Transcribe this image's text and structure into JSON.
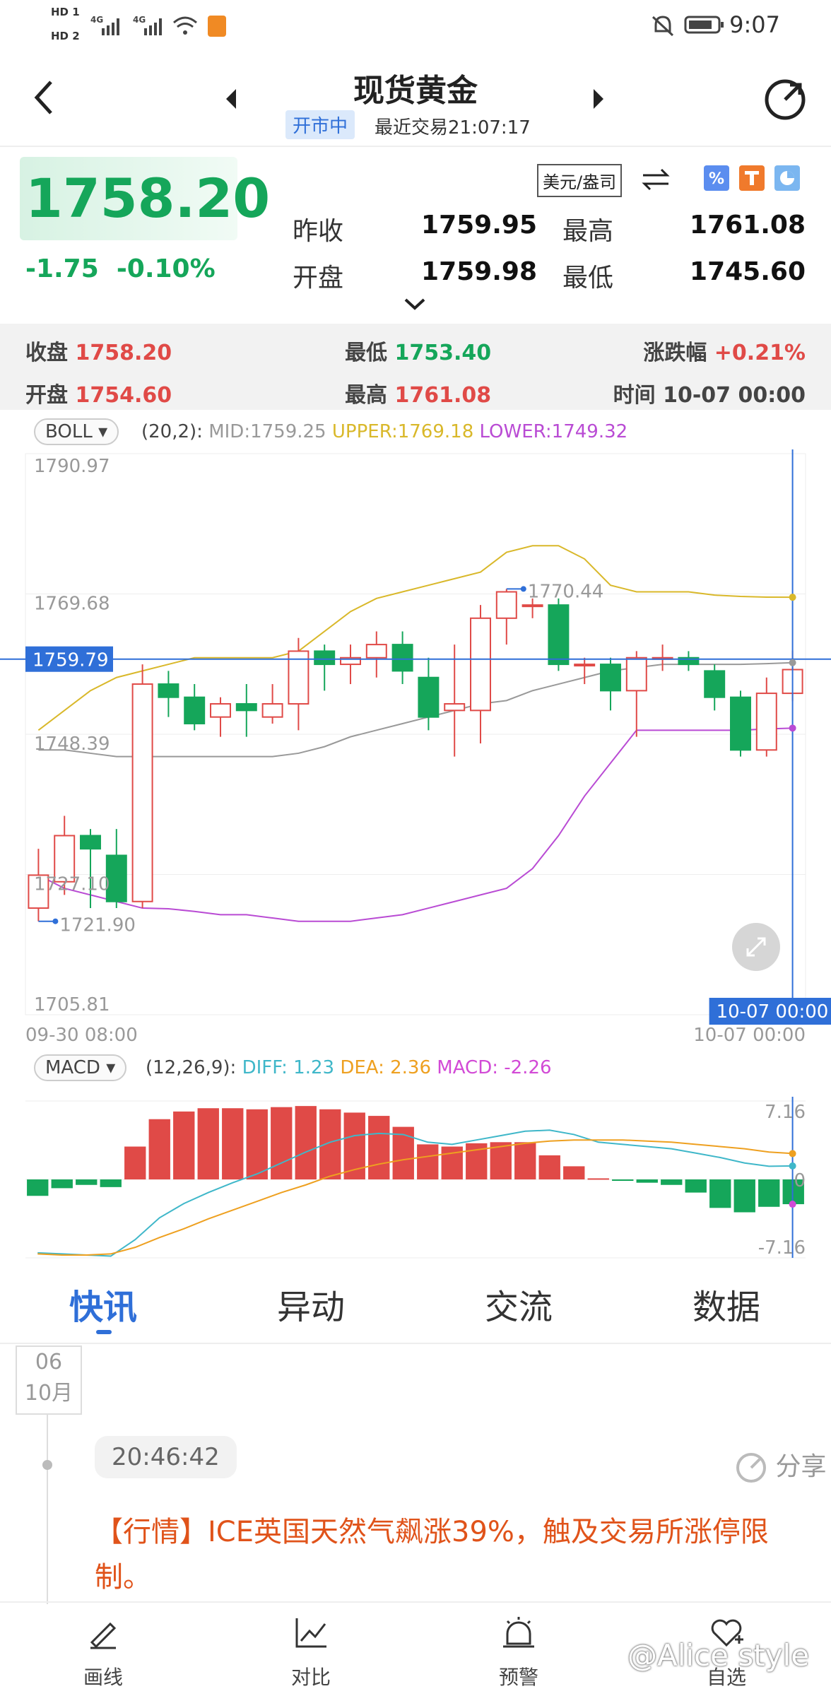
{
  "status_bar": {
    "time": "9:07",
    "hd1": "HD 1",
    "hd2": "HD 2",
    "net1": "4G",
    "net2": "4G"
  },
  "header": {
    "title": "现货黄金",
    "market_status": "开市中",
    "last_trade": "最近交易21:07:17"
  },
  "quote": {
    "price": "1758.20",
    "change": "-1.75",
    "change_pct": "-0.10%",
    "unit": "美元/盎司",
    "prev_close_label": "昨收",
    "prev_close": "1759.95",
    "open_label": "开盘",
    "open": "1759.98",
    "high_label": "最高",
    "high": "1761.08",
    "low_label": "最低",
    "low": "1745.60"
  },
  "candle_info": {
    "close_label": "收盘",
    "close": "1758.20",
    "low_label": "最低",
    "low": "1753.40",
    "chg_label": "涨跌幅",
    "chg": "+0.21%",
    "open_label": "开盘",
    "open": "1754.60",
    "high_label": "最高",
    "high": "1761.08",
    "time_label": "时间",
    "time": "10-07 00:00"
  },
  "boll": {
    "selector": "BOLL",
    "params": "(20,2):",
    "mid": "MID:1759.25",
    "upper": "UPPER:1769.18",
    "lower": "LOWER:1749.32",
    "y_ticks": [
      "1790.97",
      "1769.68",
      "1748.39",
      "1727.10",
      "1705.81"
    ],
    "cursor_price": "1759.79",
    "cursor_time": "10-07 00:00",
    "max_label": "1770.44",
    "min_label": "1721.90",
    "x_start": "09-30 08:00",
    "x_end": "10-07 00:00"
  },
  "macd": {
    "selector": "MACD",
    "params": "(12,26,9):",
    "diff": "DIFF: 1.23",
    "dea": "DEA: 2.36",
    "macd": "MACD: -2.26",
    "y_ticks": [
      "7.16",
      "0",
      "-7.16"
    ]
  },
  "colors": {
    "up": "#e04a47",
    "down": "#15a65a",
    "upper": "#d9b82a",
    "mid": "#999999",
    "lower": "#b94bd4",
    "diff": "#3fb7c9",
    "dea": "#eea020",
    "cursor": "#2f6fd8"
  },
  "chart_data": [
    {
      "type": "candlestick",
      "title": "",
      "ylim": [
        1705.81,
        1790.97
      ],
      "candles": [
        {
          "o": 1722,
          "c": 1727,
          "h": 1731,
          "l": 1720
        },
        {
          "o": 1726,
          "c": 1733,
          "h": 1736,
          "l": 1724
        },
        {
          "o": 1733,
          "c": 1731,
          "h": 1734,
          "l": 1722
        },
        {
          "o": 1730,
          "c": 1723,
          "h": 1734,
          "l": 1722
        },
        {
          "o": 1723,
          "c": 1756,
          "h": 1759,
          "l": 1722
        },
        {
          "o": 1756,
          "c": 1754,
          "h": 1758,
          "l": 1751
        },
        {
          "o": 1754,
          "c": 1750,
          "h": 1756,
          "l": 1749
        },
        {
          "o": 1751,
          "c": 1753,
          "h": 1754,
          "l": 1748
        },
        {
          "o": 1753,
          "c": 1752,
          "h": 1756,
          "l": 1748
        },
        {
          "o": 1751,
          "c": 1753,
          "h": 1756,
          "l": 1750
        },
        {
          "o": 1753,
          "c": 1761,
          "h": 1763,
          "l": 1749
        },
        {
          "o": 1761,
          "c": 1759,
          "h": 1762,
          "l": 1755
        },
        {
          "o": 1759,
          "c": 1760,
          "h": 1762,
          "l": 1756
        },
        {
          "o": 1760,
          "c": 1762,
          "h": 1764,
          "l": 1757
        },
        {
          "o": 1762,
          "c": 1758,
          "h": 1764,
          "l": 1756
        },
        {
          "o": 1757,
          "c": 1751,
          "h": 1760,
          "l": 1749
        },
        {
          "o": 1752,
          "c": 1753,
          "h": 1762,
          "l": 1745
        },
        {
          "o": 1752,
          "c": 1766,
          "h": 1768,
          "l": 1747
        },
        {
          "o": 1766,
          "c": 1770,
          "h": 1770.44,
          "l": 1762
        },
        {
          "o": 1768,
          "c": 1768,
          "h": 1769,
          "l": 1766
        },
        {
          "o": 1768,
          "c": 1759,
          "h": 1769,
          "l": 1758
        },
        {
          "o": 1759,
          "c": 1759,
          "h": 1760,
          "l": 1756
        },
        {
          "o": 1759,
          "c": 1755,
          "h": 1760,
          "l": 1752
        },
        {
          "o": 1755,
          "c": 1760,
          "h": 1761,
          "l": 1748
        },
        {
          "o": 1760,
          "c": 1760,
          "h": 1762,
          "l": 1758
        },
        {
          "o": 1760,
          "c": 1759,
          "h": 1761,
          "l": 1758
        },
        {
          "o": 1758,
          "c": 1754,
          "h": 1759,
          "l": 1752
        },
        {
          "o": 1754,
          "c": 1746,
          "h": 1755,
          "l": 1745
        },
        {
          "o": 1746,
          "c": 1754.6,
          "h": 1757,
          "l": 1745
        },
        {
          "o": 1754.6,
          "c": 1758.2,
          "h": 1761.08,
          "l": 1753.4
        }
      ],
      "upper": [
        1749,
        1752,
        1755,
        1757,
        1758,
        1759,
        1760,
        1760,
        1760,
        1760,
        1761,
        1764,
        1767,
        1769,
        1770,
        1771,
        1772,
        1773,
        1776,
        1777,
        1777,
        1775,
        1771,
        1770,
        1770,
        1770,
        1769.5,
        1769.3,
        1769.2,
        1769.18
      ],
      "mid": [
        1746,
        1746,
        1745.5,
        1745,
        1745,
        1745,
        1745,
        1745,
        1745,
        1745,
        1745.5,
        1746.5,
        1748,
        1749,
        1750,
        1751,
        1752,
        1753,
        1753.5,
        1755,
        1756,
        1757,
        1758,
        1758.5,
        1759,
        1759,
        1759,
        1759,
        1759.1,
        1759.25
      ],
      "lower": [
        1727,
        1725,
        1724,
        1723,
        1722,
        1721.9,
        1721.5,
        1721,
        1721,
        1720.5,
        1720,
        1720,
        1720,
        1720.5,
        1721,
        1722,
        1723,
        1724,
        1725,
        1728,
        1733,
        1739,
        1744,
        1749,
        1749,
        1749,
        1749,
        1749,
        1749.2,
        1749.32
      ]
    },
    {
      "type": "bar",
      "title": "",
      "ylim": [
        -7.16,
        7.16
      ],
      "macd_hist": [
        -1.5,
        -0.8,
        -0.5,
        -0.7,
        3.0,
        5.5,
        6.2,
        6.5,
        6.5,
        6.4,
        6.6,
        6.7,
        6.4,
        6.1,
        5.8,
        4.8,
        3.2,
        3.0,
        3.3,
        3.4,
        3.4,
        2.2,
        1.2,
        0.1,
        -0.1,
        -0.3,
        -0.5,
        -1.2,
        -2.6,
        -3.0,
        -2.5,
        -2.26
      ],
      "diff": [
        -6.7,
        -6.8,
        -6.9,
        -7.0,
        -5.5,
        -3.5,
        -2.2,
        -1.2,
        -0.3,
        0.5,
        1.5,
        2.5,
        3.4,
        4.0,
        4.2,
        4.1,
        3.4,
        3.2,
        3.6,
        4.0,
        4.4,
        4.5,
        4.1,
        3.4,
        3.2,
        3.0,
        2.8,
        2.4,
        2.0,
        1.5,
        1.2,
        1.23
      ],
      "dea": [
        -6.8,
        -6.9,
        -6.9,
        -6.8,
        -6.2,
        -5.3,
        -4.5,
        -3.6,
        -2.8,
        -2.0,
        -1.2,
        -0.5,
        0.3,
        0.9,
        1.4,
        1.8,
        2.1,
        2.4,
        2.7,
        3.0,
        3.3,
        3.5,
        3.6,
        3.6,
        3.6,
        3.5,
        3.4,
        3.2,
        3.0,
        2.8,
        2.5,
        2.36
      ]
    }
  ],
  "tabs": [
    "快讯",
    "异动",
    "交流",
    "数据"
  ],
  "news": {
    "day": "06",
    "month": "10月",
    "time": "20:46:42",
    "share": "分享",
    "text": "【行情】ICE英国天然气飙涨39%，触及交易所涨停限制。"
  },
  "bottom_nav": [
    "画线",
    "对比",
    "预警",
    "自选"
  ],
  "watermark": "@Alice style"
}
